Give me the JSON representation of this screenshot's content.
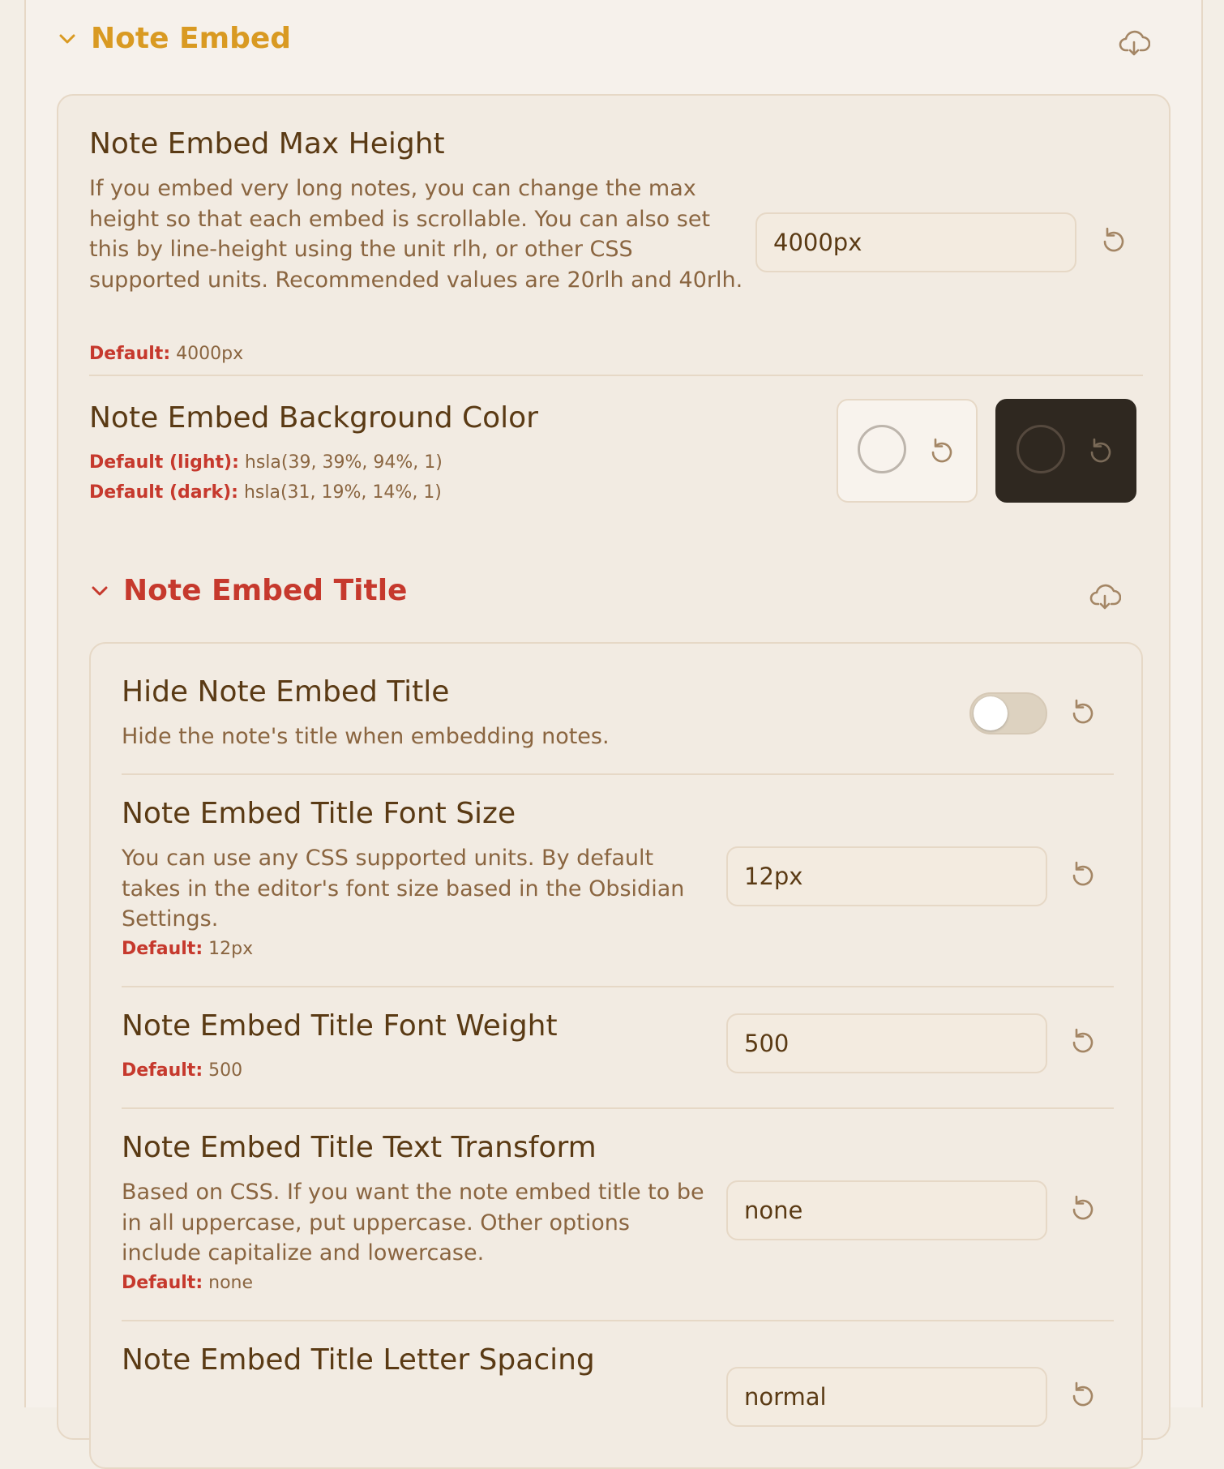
{
  "sections": {
    "note_embed": {
      "heading": "Note Embed",
      "export_icon": "cloud-download-icon"
    },
    "note_embed_title": {
      "heading": "Note Embed Title",
      "export_icon": "cloud-download-icon"
    }
  },
  "settings": {
    "max_height": {
      "title": "Note Embed Max Height",
      "description": "If you embed very long notes, you can change the max height so that each embed is scrollable. You can also set this by line-height using the unit rlh, or other CSS supported units. Recommended values are 20rlh and 40rlh.",
      "default_label": "Default:",
      "default_value": "4000px",
      "value": "4000px"
    },
    "background_color": {
      "title": "Note Embed Background Color",
      "default_light_label": "Default (light):",
      "default_light_value": "hsla(39, 39%, 94%, 1)",
      "default_dark_label": "Default (dark):",
      "default_dark_value": "hsla(31, 19%, 14%, 1)"
    },
    "hide_title": {
      "title": "Hide Note Embed Title",
      "description": "Hide the note's title when embedding notes.",
      "enabled": false
    },
    "title_font_size": {
      "title": "Note Embed Title Font Size",
      "description": "You can use any CSS supported units. By default takes in the editor's font size based in the Obsidian Settings.",
      "default_label": "Default:",
      "default_value": "12px",
      "value": "12px"
    },
    "title_font_weight": {
      "title": "Note Embed Title Font Weight",
      "default_label": "Default:",
      "default_value": "500",
      "value": "500"
    },
    "title_text_transform": {
      "title": "Note Embed Title Text Transform",
      "description": "Based on CSS. If you want the note embed title to be in all uppercase, put uppercase. Other options include capitalize and lowercase.",
      "default_label": "Default:",
      "default_value": "none",
      "value": "none"
    },
    "title_letter_spacing": {
      "title": "Note Embed Title Letter Spacing",
      "value": "normal"
    }
  },
  "icons": {
    "chevron": "chevron-down-icon",
    "reset": "reset-icon"
  },
  "colors": {
    "heading_gold": "#d99a22",
    "heading_red": "#c6392d",
    "title_brown": "#5a3a14",
    "desc_brown": "#8a6540",
    "default_label_red": "#c6392d"
  }
}
